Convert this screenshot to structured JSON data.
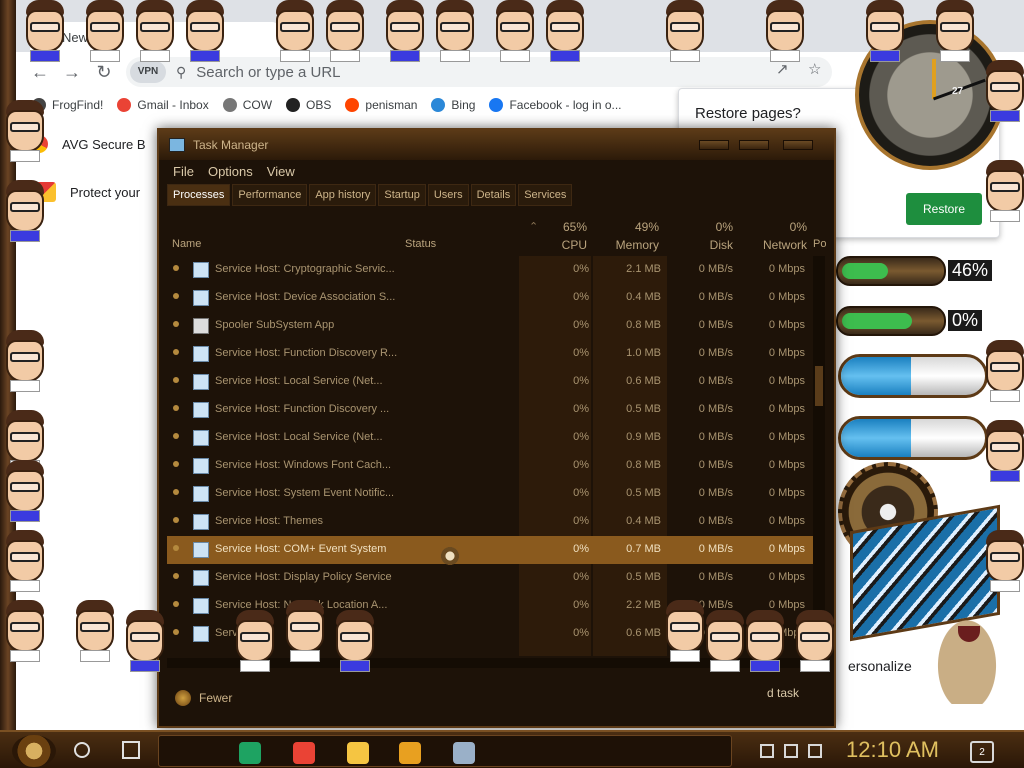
{
  "browser": {
    "tab_title": "New Tab",
    "new_tab_symbol": "+",
    "vpn_badge": "VPN",
    "search_placeholder": "Search or type a URL",
    "bookmarks": [
      {
        "label": "FrogFind!",
        "icon": "frog-icon",
        "color": "#444444"
      },
      {
        "label": "Gmail - Inbox",
        "icon": "gmail-icon",
        "color": "#ea4335"
      },
      {
        "label": "COW",
        "icon": "globe-icon",
        "color": "#777777"
      },
      {
        "label": "OBS",
        "icon": "github-icon",
        "color": "#222222"
      },
      {
        "label": "penisman",
        "icon": "reddit-icon",
        "color": "#ff4500"
      },
      {
        "label": "Bing",
        "icon": "bing-icon",
        "color": "#2b88d8"
      },
      {
        "label": "Facebook - log in o...",
        "icon": "facebook-icon",
        "color": "#1877f2"
      }
    ],
    "ext_rows": {
      "avg": "AVG Secure B",
      "protect": "Protect your"
    },
    "restore": {
      "title": "Restore pages?",
      "button": "Restore"
    },
    "personalize": "ersonalize"
  },
  "widgets": {
    "clock_date": "27",
    "gauge1": {
      "label": "46%",
      "fill": 0.46,
      "color": "#3dbd4e"
    },
    "gauge2": {
      "label": "0%",
      "fill": 0.0,
      "color": "#3dbd4e"
    }
  },
  "task_manager": {
    "title": "Task Manager",
    "menu": [
      "File",
      "Options",
      "View"
    ],
    "tabs": [
      "Processes",
      "Performance",
      "App history",
      "Startup",
      "Users",
      "Details",
      "Services"
    ],
    "active_tab": "Processes",
    "headers": {
      "name": "Name",
      "status": "Status",
      "cpu_pct": "65%",
      "cpu": "CPU",
      "mem_pct": "49%",
      "mem": "Memory",
      "disk_pct": "0%",
      "disk": "Disk",
      "net_pct": "0%",
      "net": "Network",
      "power": "Po"
    },
    "rows": [
      {
        "name": "Service Host: Cryptographic Servic...",
        "cpu": "0%",
        "mem": "2.1 MB",
        "disk": "0 MB/s",
        "net": "0 Mbps",
        "icon": "service-icon"
      },
      {
        "name": "Service Host: Device Association S...",
        "cpu": "0%",
        "mem": "0.4 MB",
        "disk": "0 MB/s",
        "net": "0 Mbps",
        "icon": "service-icon"
      },
      {
        "name": "Spooler SubSystem App",
        "cpu": "0%",
        "mem": "0.8 MB",
        "disk": "0 MB/s",
        "net": "0 Mbps",
        "icon": "printer-icon"
      },
      {
        "name": "Service Host: Function Discovery R...",
        "cpu": "0%",
        "mem": "1.0 MB",
        "disk": "0 MB/s",
        "net": "0 Mbps",
        "icon": "service-icon"
      },
      {
        "name": "Service Host: Local Service (Net...",
        "cpu": "0%",
        "mem": "0.6 MB",
        "disk": "0 MB/s",
        "net": "0 Mbps",
        "icon": "service-icon"
      },
      {
        "name": "Service Host: Function Discovery ...",
        "cpu": "0%",
        "mem": "0.5 MB",
        "disk": "0 MB/s",
        "net": "0 Mbps",
        "icon": "service-icon"
      },
      {
        "name": "Service Host: Local Service (Net...",
        "cpu": "0%",
        "mem": "0.9 MB",
        "disk": "0 MB/s",
        "net": "0 Mbps",
        "icon": "service-icon"
      },
      {
        "name": "Service Host: Windows Font Cach...",
        "cpu": "0%",
        "mem": "0.8 MB",
        "disk": "0 MB/s",
        "net": "0 Mbps",
        "icon": "service-icon"
      },
      {
        "name": "Service Host: System Event Notific...",
        "cpu": "0%",
        "mem": "0.5 MB",
        "disk": "0 MB/s",
        "net": "0 Mbps",
        "icon": "service-icon"
      },
      {
        "name": "Service Host: Themes",
        "cpu": "0%",
        "mem": "0.4 MB",
        "disk": "0 MB/s",
        "net": "0 Mbps",
        "icon": "service-icon"
      },
      {
        "name": "Service Host: COM+ Event System",
        "cpu": "0%",
        "mem": "0.7 MB",
        "disk": "0 MB/s",
        "net": "0 Mbps",
        "icon": "service-icon",
        "selected": true
      },
      {
        "name": "Service Host: Display Policy Service",
        "cpu": "0%",
        "mem": "0.5 MB",
        "disk": "0 MB/s",
        "net": "0 Mbps",
        "icon": "service-icon"
      },
      {
        "name": "Service Host: Network Location A...",
        "cpu": "0%",
        "mem": "2.2 MB",
        "disk": "0 MB/s",
        "net": "0 Mbps",
        "icon": "service-icon"
      },
      {
        "name": "Service H",
        "cpu": "0%",
        "mem": "0.6 MB",
        "disk": "0 MB/s",
        "net": "0 Mbps",
        "icon": "service-icon"
      }
    ],
    "footer": {
      "fewer_details": "Fewer",
      "end_task": "d task"
    }
  },
  "taskbar": {
    "time": "12:10 AM",
    "notifications": "2",
    "apps": [
      {
        "name": "sheets-icon",
        "color": "#1ea362"
      },
      {
        "name": "chrome-icon",
        "color": "#ea4335"
      },
      {
        "name": "file-explorer-icon",
        "color": "#f5c542"
      },
      {
        "name": "avg-browser-icon",
        "color": "#e8a020"
      },
      {
        "name": "task-manager-icon",
        "color": "#9ab0c8"
      }
    ]
  }
}
